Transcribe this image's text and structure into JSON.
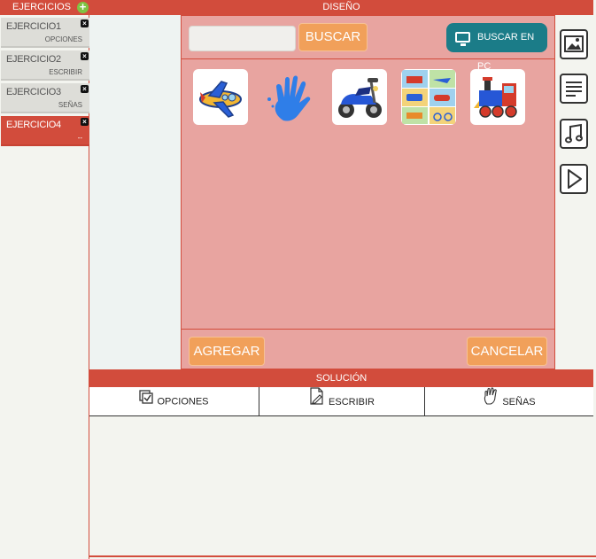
{
  "left_panel": {
    "title": "EJERCICIOS",
    "add_icon": "plus-circle-icon",
    "items": [
      {
        "name": "EJERCICIO1",
        "subtitle": "OPCIONES",
        "active": false
      },
      {
        "name": "EJERCICIO2",
        "subtitle": "ESCRIBIR",
        "active": false
      },
      {
        "name": "EJERCICIO3",
        "subtitle": "SEÑAS",
        "active": false
      },
      {
        "name": "EJERCICIO4",
        "subtitle": "--",
        "active": true
      }
    ]
  },
  "design": {
    "title": "DISEÑO",
    "search_placeholder": "",
    "search_button": "BUSCAR",
    "search_pc_button": "BUSCAR EN PC",
    "images": [
      {
        "icon": "airplane-image"
      },
      {
        "icon": "blue-hand-image"
      },
      {
        "icon": "scooter-image"
      },
      {
        "icon": "transport-collage-image"
      },
      {
        "icon": "toy-train-image"
      }
    ],
    "add_button": "AGREGAR",
    "cancel_button": "CANCELAR"
  },
  "tools": [
    {
      "icon": "image-icon"
    },
    {
      "icon": "text-icon"
    },
    {
      "icon": "music-icon"
    },
    {
      "icon": "play-icon"
    }
  ],
  "solution": {
    "title": "SOLUCIÓN",
    "tabs": [
      {
        "label": "OPCIONES",
        "icon": "checkbox-icon"
      },
      {
        "label": "ESCRIBIR",
        "icon": "document-pencil-icon"
      },
      {
        "label": "SEÑAS",
        "icon": "hand-icon"
      }
    ]
  },
  "colors": {
    "accent": "#d24c3c",
    "design_bg": "#e8a4a0",
    "button_orange": "#f1a05a",
    "button_teal": "#1b7c88"
  }
}
